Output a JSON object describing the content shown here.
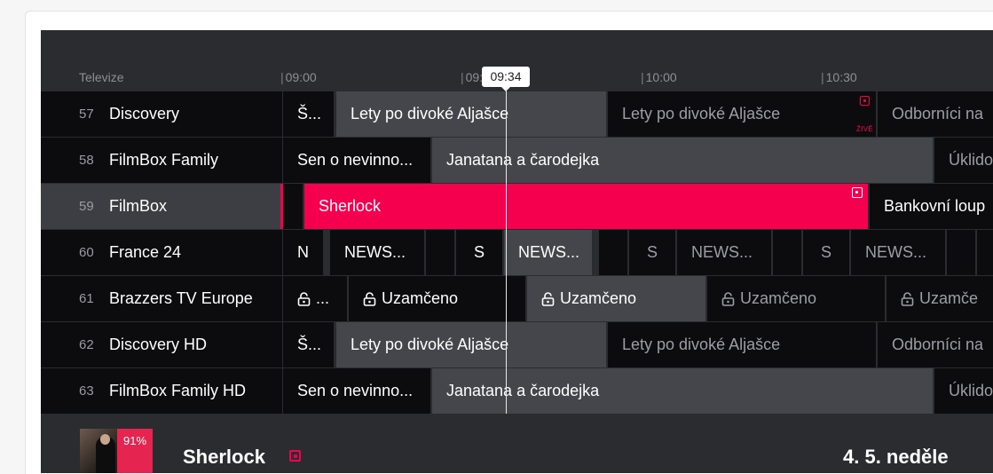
{
  "timeline": {
    "header": "Televize",
    "ticks": [
      "09:00",
      "09:30",
      "10:00",
      "10:30"
    ],
    "now": "09:34"
  },
  "channels": [
    {
      "num": "57",
      "name": "Discovery"
    },
    {
      "num": "58",
      "name": "FilmBox Family"
    },
    {
      "num": "59",
      "name": "FilmBox"
    },
    {
      "num": "60",
      "name": "France 24"
    },
    {
      "num": "61",
      "name": "Brazzers TV Europe"
    },
    {
      "num": "62",
      "name": "Discovery HD"
    },
    {
      "num": "63",
      "name": "FilmBox Family HD"
    }
  ],
  "programs": {
    "discovery": [
      "Š...",
      "Lety po divoké Aljašce",
      "Lety po divoké Aljašce",
      "Odborníci na"
    ],
    "filmbox_family": [
      "Sen o nevinno...",
      "Janatana a čarodejka",
      "Úklidová"
    ],
    "filmbox": [
      "Sherlock",
      "Bankovní loup"
    ],
    "france24": [
      "N",
      "NEWS...",
      "S",
      "NEWS...",
      "S",
      "NEWS...",
      "S",
      "NEWS..."
    ],
    "brazzers": [
      "...",
      "Uzamčeno",
      "Uzamčeno",
      "Uzamčeno",
      "Uzamče"
    ],
    "discovery_hd": [
      "Š...",
      "Lety po divoké Aljašce",
      "Lety po divoké Aljašce",
      "Odborníci na"
    ],
    "filmbox_family_hd": [
      "Sen o nevinno...",
      "Janatana a čarodejka",
      "Úklidová"
    ]
  },
  "live_label": "ŽIVĚ",
  "icons": {
    "live": "live-record-icon",
    "lock": "lock-icon",
    "record": "record-icon"
  },
  "colors": {
    "accent": "#f4004f",
    "cell_dark": "#0c0c0e",
    "cell_light": "#45464c",
    "background": "#2b2c30"
  },
  "detail": {
    "title": "Sherlock",
    "rating": "91%",
    "date": "4. 5. neděle"
  }
}
